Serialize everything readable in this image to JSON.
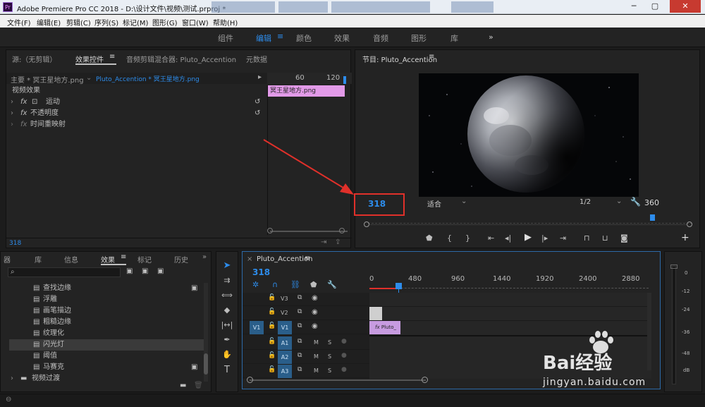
{
  "window": {
    "title": "Adobe Premiere Pro CC 2018 - D:\\设计文件\\视频\\测试.prproj *",
    "buttons": {
      "minimize": "─",
      "maximize": "▢",
      "close": "✕"
    }
  },
  "menu": [
    "文件(F)",
    "编辑(E)",
    "剪辑(C)",
    "序列(S)",
    "标记(M)",
    "图形(G)",
    "窗口(W)",
    "帮助(H)"
  ],
  "workspaces": [
    "组件",
    "编辑",
    "颜色",
    "效果",
    "音频",
    "图形",
    "库",
    "»"
  ],
  "effect_controls": {
    "tabs": [
      "源:（无剪辑）",
      "效果控件",
      "音频剪辑混合器: Pluto_Accention",
      "元数据"
    ],
    "master": "主要 * 冥王星地方.png",
    "sequence_clip": "Pluto_Accention * 冥王星地方.png",
    "ruler": [
      "60",
      "120"
    ],
    "section": "视频效果",
    "effects": [
      {
        "label": "运动"
      },
      {
        "label": "不透明度"
      },
      {
        "label": "时间重映射"
      }
    ],
    "clip_label": "冥王星地方.png",
    "timecode": "318"
  },
  "program": {
    "title": "节目: Pluto_Accention",
    "timecode": "318",
    "fit": "适合",
    "resolution": "1/2",
    "duration": "360"
  },
  "effects_panel": {
    "tabs": [
      "器",
      "库",
      "信息",
      "效果",
      "标记",
      "历史"
    ],
    "items": [
      "查找边缘",
      "浮雕",
      "画笔描边",
      "粗糙边缘",
      "纹理化",
      "闪光灯",
      "阈值",
      "马赛克"
    ],
    "folder": "视频过渡"
  },
  "timeline": {
    "sequence_name": "Pluto_Accention",
    "timecode": "318",
    "ruler": [
      "0",
      "480",
      "960",
      "1440",
      "1920",
      "2400",
      "2880"
    ],
    "video_tracks": [
      {
        "name": "V3"
      },
      {
        "name": "V2"
      },
      {
        "name": "V1",
        "source": "V1"
      }
    ],
    "audio_tracks": [
      {
        "name": "A1"
      },
      {
        "name": "A2"
      },
      {
        "name": "A3"
      }
    ],
    "m_label": "M",
    "s_label": "S",
    "clip_label": "Pluto_"
  },
  "meter": {
    "labels": [
      "0",
      "-12",
      "-24",
      "-36",
      "-48",
      "dB"
    ]
  },
  "watermark": {
    "line1": "Bai经验",
    "line2": "jingyan.baidu.com"
  }
}
